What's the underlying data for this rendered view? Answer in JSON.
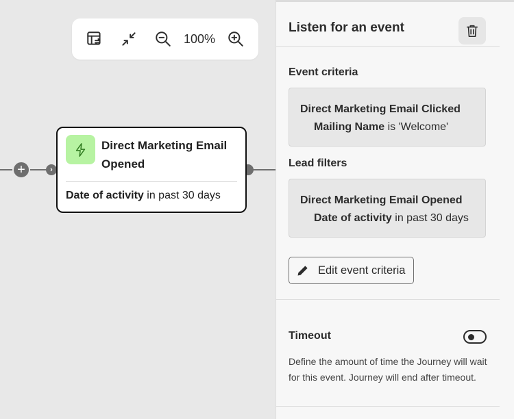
{
  "toolbar": {
    "zoom_level": "100%",
    "icons": [
      "fit-to-screen-icon",
      "collapse-icon",
      "zoom-out-icon",
      "zoom-in-icon"
    ]
  },
  "node": {
    "title": "Direct Marketing Email Opened",
    "icon": "lightning-bolt-icon",
    "filter_field": "Date of activity",
    "filter_condition": "in past 30 days",
    "icon_bg_color": "#b7f3a2"
  },
  "panel": {
    "title": "Listen for an event",
    "event_criteria_label": "Event criteria",
    "event_criteria": {
      "event": "Direct Marketing Email Clicked",
      "field": "Mailing Name",
      "condition": "is 'Welcome'"
    },
    "lead_filters_label": "Lead filters",
    "lead_filters": {
      "event": "Direct Marketing Email Opened",
      "field": "Date of activity",
      "condition": "in past 30 days"
    },
    "edit_button_label": "Edit event criteria",
    "timeout_label": "Timeout",
    "timeout_description": "Define the amount of time the Journey will wait for this event. Journey will end after timeout."
  }
}
